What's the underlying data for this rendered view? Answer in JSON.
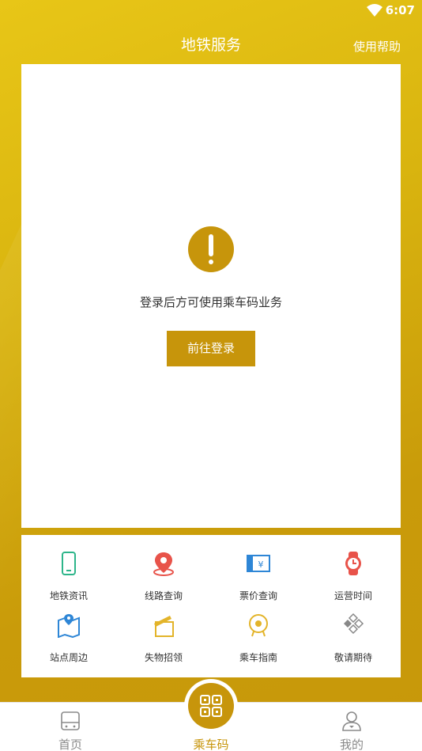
{
  "status_bar": {
    "time": "6:07"
  },
  "header": {
    "title": "地铁服务",
    "help_label": "使用帮助"
  },
  "main": {
    "message": "登录后方可使用乘车码业务",
    "login_button": "前往登录"
  },
  "services": [
    {
      "label": "地铁资讯",
      "icon": "phone-icon"
    },
    {
      "label": "线路查询",
      "icon": "location-pin-icon"
    },
    {
      "label": "票价查询",
      "icon": "ticket-icon"
    },
    {
      "label": "运营时间",
      "icon": "clock-icon"
    },
    {
      "label": "站点周边",
      "icon": "map-icon"
    },
    {
      "label": "失物招领",
      "icon": "box-icon"
    },
    {
      "label": "乘车指南",
      "icon": "guide-icon"
    },
    {
      "label": "敬请期待",
      "icon": "diamond-grid-icon"
    }
  ],
  "tabbar": {
    "items": [
      {
        "label": "首页",
        "icon": "train-icon"
      },
      {
        "label": "乘车码",
        "icon": "qr-code-icon"
      },
      {
        "label": "我的",
        "icon": "user-icon"
      }
    ]
  },
  "colors": {
    "accent": "#c7950b",
    "background": "#dcb612"
  }
}
